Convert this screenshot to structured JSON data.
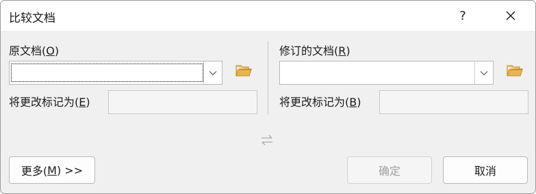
{
  "dialog": {
    "title": "比较文档",
    "help_glyph": "?",
    "close_glyph": "✕"
  },
  "original": {
    "label_pre": "原文档(",
    "label_key": "O",
    "label_post": ")",
    "value": "",
    "mark_pre": "将更改标记为(",
    "mark_key": "E",
    "mark_post": ")",
    "mark_value": ""
  },
  "revised": {
    "label_pre": "修订的文档(",
    "label_key": "R",
    "label_post": ")",
    "value": "",
    "mark_pre": "将更改标记为(",
    "mark_key": "B",
    "mark_post": ")",
    "mark_value": ""
  },
  "buttons": {
    "more_pre": "更多(",
    "more_key": "M",
    "more_post": ") >>",
    "ok": "确定",
    "cancel": "取消"
  },
  "icons": {
    "dropdown": "chevron-down-icon",
    "browse": "folder-icon",
    "swap": "swap-arrows-icon",
    "folder_color": "#dcae4e"
  }
}
